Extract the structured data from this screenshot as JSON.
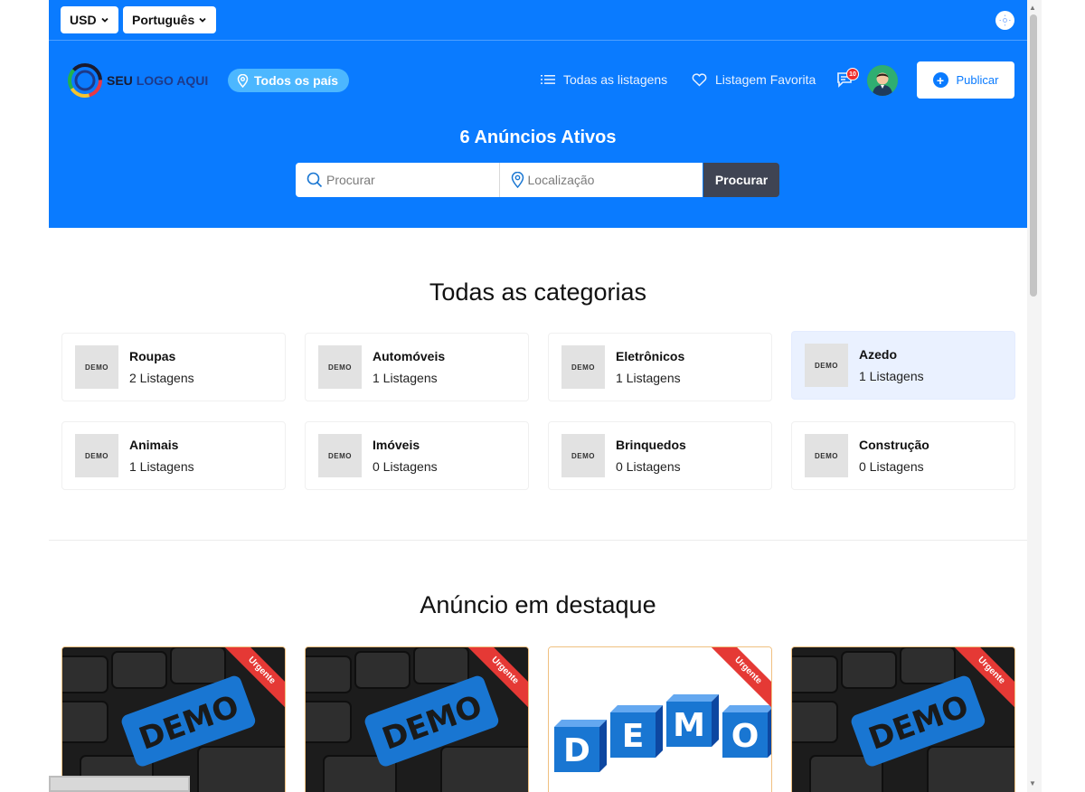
{
  "topbar": {
    "currency": "USD",
    "language": "Português"
  },
  "header": {
    "logo": {
      "part1": "SEU",
      "part2": "LOGO AQUI"
    },
    "country_filter": "Todos os país",
    "nav": {
      "all_listings": "Todas as listagens",
      "favorites": "Listagem Favorita"
    },
    "chat_badge": "10",
    "publish_label": "Publicar"
  },
  "hero": {
    "title": "6 Anúncios Ativos",
    "search_placeholder": "Procurar",
    "location_placeholder": "Localização",
    "search_button": "Procurar"
  },
  "categories": {
    "title": "Todas as categorias",
    "thumb_text": "DEMO",
    "items": [
      {
        "name": "Roupas",
        "count": "2 Listagens"
      },
      {
        "name": "Automóveis",
        "count": "1 Listagens"
      },
      {
        "name": "Eletrônicos",
        "count": "1 Listagens"
      },
      {
        "name": "Azedo",
        "count": "1 Listagens"
      },
      {
        "name": "Animais",
        "count": "1 Listagens"
      },
      {
        "name": "Imóveis",
        "count": "0 Listagens"
      },
      {
        "name": "Brinquedos",
        "count": "0 Listagens"
      },
      {
        "name": "Construção",
        "count": "0 Listagens"
      }
    ]
  },
  "featured": {
    "title": "Anúncio em destaque",
    "cards": [
      {
        "ribbon": "Urgente",
        "image_text": "DEMO"
      },
      {
        "ribbon": "Urgente",
        "image_text": "DEMO"
      },
      {
        "ribbon": "Urgente",
        "image_text": "DEMO"
      },
      {
        "ribbon": "Urgente",
        "image_text": "DEMO"
      }
    ]
  },
  "colors": {
    "primary": "#0a7bff",
    "pill": "#4cb7ff",
    "search_button": "#3f4453",
    "ribbon": "#e53935",
    "active_category": "#eaf1ff"
  }
}
